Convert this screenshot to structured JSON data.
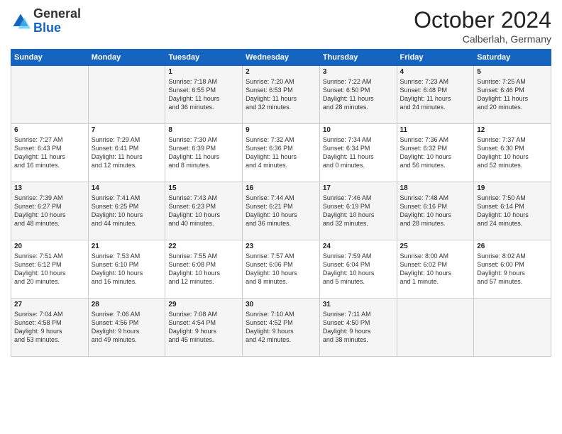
{
  "header": {
    "logo_general": "General",
    "logo_blue": "Blue",
    "month": "October 2024",
    "location": "Calberlah, Germany"
  },
  "days_of_week": [
    "Sunday",
    "Monday",
    "Tuesday",
    "Wednesday",
    "Thursday",
    "Friday",
    "Saturday"
  ],
  "weeks": [
    [
      {
        "day": "",
        "info": ""
      },
      {
        "day": "",
        "info": ""
      },
      {
        "day": "1",
        "info": "Sunrise: 7:18 AM\nSunset: 6:55 PM\nDaylight: 11 hours\nand 36 minutes."
      },
      {
        "day": "2",
        "info": "Sunrise: 7:20 AM\nSunset: 6:53 PM\nDaylight: 11 hours\nand 32 minutes."
      },
      {
        "day": "3",
        "info": "Sunrise: 7:22 AM\nSunset: 6:50 PM\nDaylight: 11 hours\nand 28 minutes."
      },
      {
        "day": "4",
        "info": "Sunrise: 7:23 AM\nSunset: 6:48 PM\nDaylight: 11 hours\nand 24 minutes."
      },
      {
        "day": "5",
        "info": "Sunrise: 7:25 AM\nSunset: 6:46 PM\nDaylight: 11 hours\nand 20 minutes."
      }
    ],
    [
      {
        "day": "6",
        "info": "Sunrise: 7:27 AM\nSunset: 6:43 PM\nDaylight: 11 hours\nand 16 minutes."
      },
      {
        "day": "7",
        "info": "Sunrise: 7:29 AM\nSunset: 6:41 PM\nDaylight: 11 hours\nand 12 minutes."
      },
      {
        "day": "8",
        "info": "Sunrise: 7:30 AM\nSunset: 6:39 PM\nDaylight: 11 hours\nand 8 minutes."
      },
      {
        "day": "9",
        "info": "Sunrise: 7:32 AM\nSunset: 6:36 PM\nDaylight: 11 hours\nand 4 minutes."
      },
      {
        "day": "10",
        "info": "Sunrise: 7:34 AM\nSunset: 6:34 PM\nDaylight: 11 hours\nand 0 minutes."
      },
      {
        "day": "11",
        "info": "Sunrise: 7:36 AM\nSunset: 6:32 PM\nDaylight: 10 hours\nand 56 minutes."
      },
      {
        "day": "12",
        "info": "Sunrise: 7:37 AM\nSunset: 6:30 PM\nDaylight: 10 hours\nand 52 minutes."
      }
    ],
    [
      {
        "day": "13",
        "info": "Sunrise: 7:39 AM\nSunset: 6:27 PM\nDaylight: 10 hours\nand 48 minutes."
      },
      {
        "day": "14",
        "info": "Sunrise: 7:41 AM\nSunset: 6:25 PM\nDaylight: 10 hours\nand 44 minutes."
      },
      {
        "day": "15",
        "info": "Sunrise: 7:43 AM\nSunset: 6:23 PM\nDaylight: 10 hours\nand 40 minutes."
      },
      {
        "day": "16",
        "info": "Sunrise: 7:44 AM\nSunset: 6:21 PM\nDaylight: 10 hours\nand 36 minutes."
      },
      {
        "day": "17",
        "info": "Sunrise: 7:46 AM\nSunset: 6:19 PM\nDaylight: 10 hours\nand 32 minutes."
      },
      {
        "day": "18",
        "info": "Sunrise: 7:48 AM\nSunset: 6:16 PM\nDaylight: 10 hours\nand 28 minutes."
      },
      {
        "day": "19",
        "info": "Sunrise: 7:50 AM\nSunset: 6:14 PM\nDaylight: 10 hours\nand 24 minutes."
      }
    ],
    [
      {
        "day": "20",
        "info": "Sunrise: 7:51 AM\nSunset: 6:12 PM\nDaylight: 10 hours\nand 20 minutes."
      },
      {
        "day": "21",
        "info": "Sunrise: 7:53 AM\nSunset: 6:10 PM\nDaylight: 10 hours\nand 16 minutes."
      },
      {
        "day": "22",
        "info": "Sunrise: 7:55 AM\nSunset: 6:08 PM\nDaylight: 10 hours\nand 12 minutes."
      },
      {
        "day": "23",
        "info": "Sunrise: 7:57 AM\nSunset: 6:06 PM\nDaylight: 10 hours\nand 8 minutes."
      },
      {
        "day": "24",
        "info": "Sunrise: 7:59 AM\nSunset: 6:04 PM\nDaylight: 10 hours\nand 5 minutes."
      },
      {
        "day": "25",
        "info": "Sunrise: 8:00 AM\nSunset: 6:02 PM\nDaylight: 10 hours\nand 1 minute."
      },
      {
        "day": "26",
        "info": "Sunrise: 8:02 AM\nSunset: 6:00 PM\nDaylight: 9 hours\nand 57 minutes."
      }
    ],
    [
      {
        "day": "27",
        "info": "Sunrise: 7:04 AM\nSunset: 4:58 PM\nDaylight: 9 hours\nand 53 minutes."
      },
      {
        "day": "28",
        "info": "Sunrise: 7:06 AM\nSunset: 4:56 PM\nDaylight: 9 hours\nand 49 minutes."
      },
      {
        "day": "29",
        "info": "Sunrise: 7:08 AM\nSunset: 4:54 PM\nDaylight: 9 hours\nand 45 minutes."
      },
      {
        "day": "30",
        "info": "Sunrise: 7:10 AM\nSunset: 4:52 PM\nDaylight: 9 hours\nand 42 minutes."
      },
      {
        "day": "31",
        "info": "Sunrise: 7:11 AM\nSunset: 4:50 PM\nDaylight: 9 hours\nand 38 minutes."
      },
      {
        "day": "",
        "info": ""
      },
      {
        "day": "",
        "info": ""
      }
    ]
  ]
}
